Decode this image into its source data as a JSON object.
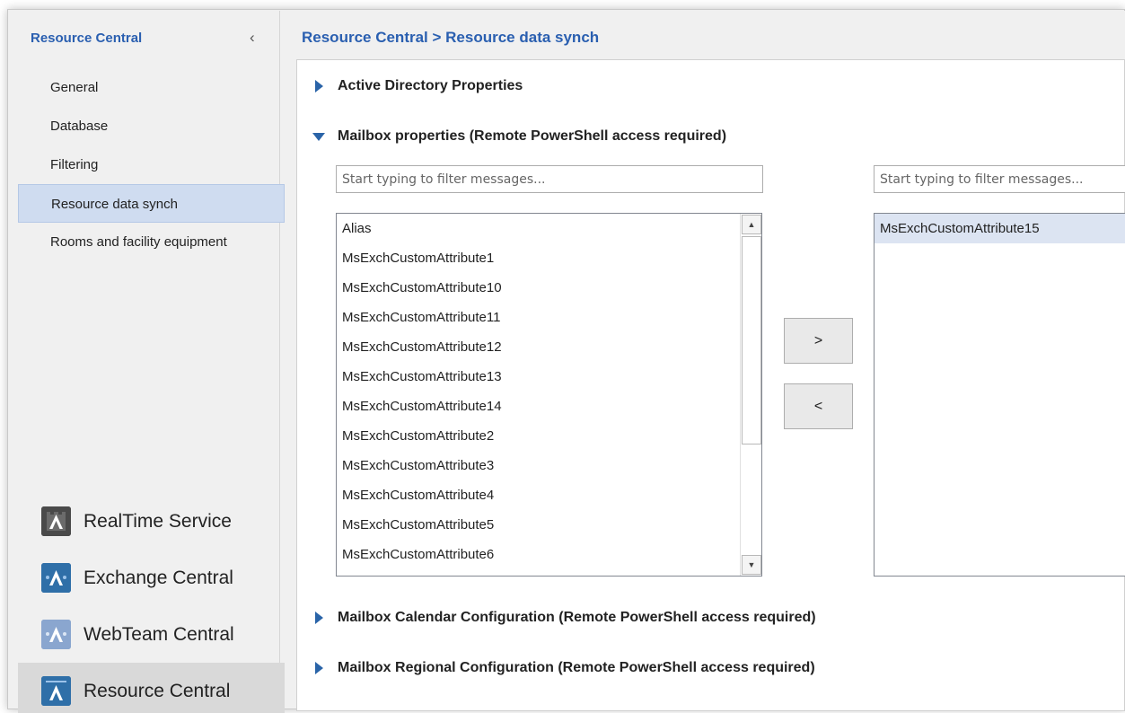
{
  "sidebar": {
    "title": "Resource Central",
    "collapse_glyph": "‹",
    "items": [
      {
        "label": "General"
      },
      {
        "label": "Database"
      },
      {
        "label": "Filtering"
      },
      {
        "label": "Resource data synch",
        "selected": true
      },
      {
        "label": "Rooms and facility equipment"
      }
    ],
    "modules": [
      {
        "label": "RealTime Service",
        "icon": "realtime-service-icon"
      },
      {
        "label": "Exchange Central",
        "icon": "exchange-central-icon"
      },
      {
        "label": "WebTeam Central",
        "icon": "webteam-central-icon"
      },
      {
        "label": "Resource Central",
        "icon": "resource-central-icon",
        "active": true
      }
    ]
  },
  "main": {
    "breadcrumb": "Resource Central > Resource data synch",
    "sections": {
      "active_directory": "Active Directory Properties",
      "mailbox_properties": "Mailbox properties (Remote PowerShell access required)",
      "calendar_config": "Mailbox Calendar Configuration (Remote PowerShell access required)",
      "regional_config": "Mailbox Regional Configuration (Remote PowerShell access required)"
    },
    "left_filter_placeholder": "Start typing to filter messages...",
    "right_filter_placeholder": "Start typing to filter messages...",
    "available_items": [
      "Alias",
      "MsExchCustomAttribute1",
      "MsExchCustomAttribute10",
      "MsExchCustomAttribute11",
      "MsExchCustomAttribute12",
      "MsExchCustomAttribute13",
      "MsExchCustomAttribute14",
      "MsExchCustomAttribute2",
      "MsExchCustomAttribute3",
      "MsExchCustomAttribute4",
      "MsExchCustomAttribute5",
      "MsExchCustomAttribute6"
    ],
    "selected_items": [
      "MsExchCustomAttribute15"
    ],
    "add_button": ">",
    "remove_button": "<",
    "scroll_up_glyph": "▲",
    "scroll_down_glyph": "▼"
  },
  "colors": {
    "accent": "#2a5fb0",
    "selection": "#cfdcf0"
  }
}
